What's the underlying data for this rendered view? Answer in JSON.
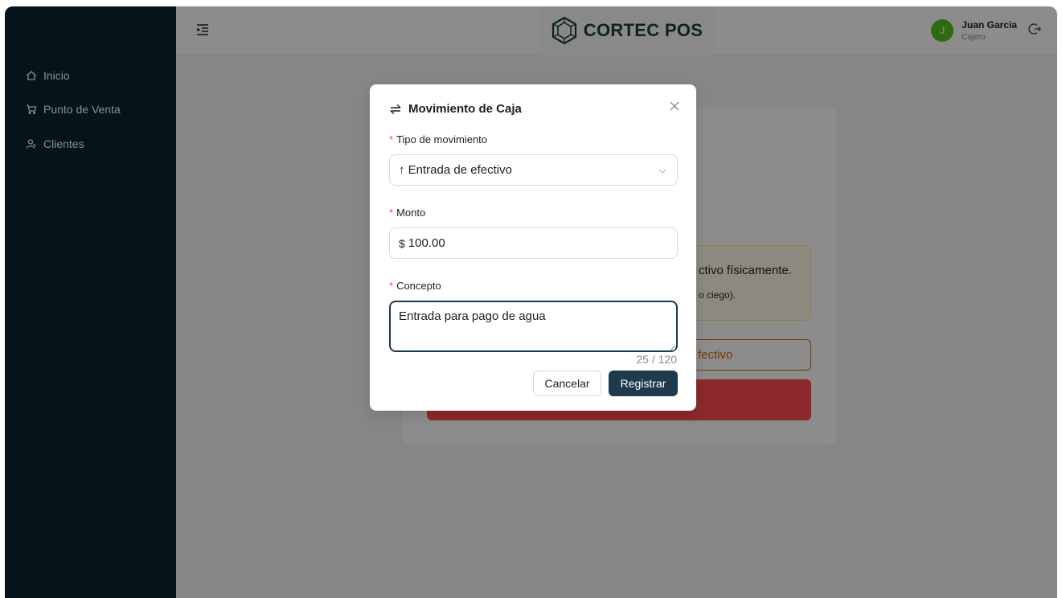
{
  "sidebar": {
    "items": [
      {
        "label": "Inicio",
        "icon": "home-icon"
      },
      {
        "label": "Punto de Venta",
        "icon": "cart-icon"
      },
      {
        "label": "Clientes",
        "icon": "users-icon"
      }
    ]
  },
  "header": {
    "brand": "CORTEC POS",
    "user": {
      "initial": "J",
      "name": "Juan Garcia",
      "role": "Cajero"
    }
  },
  "background": {
    "notice_line1": "ctivo físicamente.",
    "notice_line2": "o ciego).",
    "outline_button_partial": "fectivo"
  },
  "modal": {
    "title": "Movimiento de Caja",
    "tipo": {
      "label": "Tipo de movimiento",
      "value": "↑ Entrada de efectivo"
    },
    "monto": {
      "label": "Monto",
      "prefix": "$",
      "value": "100.00"
    },
    "concepto": {
      "label": "Concepto",
      "value": "Entrada para pago de agua",
      "counter": "25 / 120"
    },
    "cancel_label": "Cancelar",
    "submit_label": "Registrar"
  },
  "colors": {
    "sidebar_bg": "#0a2330",
    "primary": "#1e3a4c",
    "avatar": "#52c41a",
    "danger": "#ff4d4f",
    "warning": "#d46b08",
    "required": "#ff4d4f"
  }
}
